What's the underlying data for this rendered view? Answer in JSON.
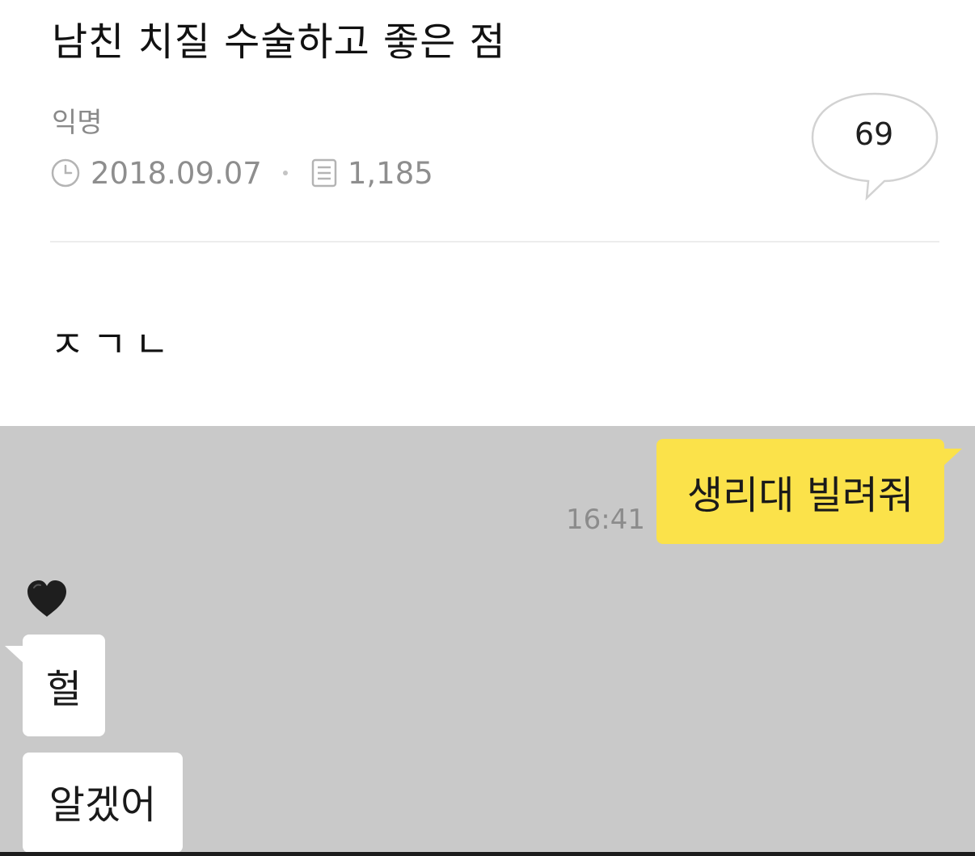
{
  "post": {
    "title": "남친 치질 수술하고 좋은 점",
    "author": "익명",
    "date": "2018.09.07",
    "views": "1,185",
    "comment_count": "69",
    "body": "ㅈㄱㄴ",
    "icons": {
      "date": "clock-icon",
      "views": "document-icon",
      "comments": "speech-bubble-icon"
    }
  },
  "chat": {
    "background": "#c9c9c9",
    "outgoing": {
      "text": "생리대 빌려줘",
      "time": "16:41",
      "color": "#fbe24a"
    },
    "sender_avatar_icon": "black-heart-icon",
    "incoming": [
      {
        "text": "헐"
      },
      {
        "text": "알겠어"
      }
    ]
  }
}
